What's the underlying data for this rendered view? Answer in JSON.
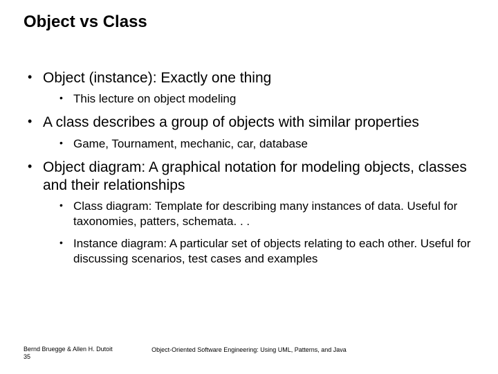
{
  "title": "Object vs Class",
  "bullets": {
    "b1": "Object (instance): Exactly one thing",
    "b1_1": " This lecture on object modeling",
    "b2": "A class describes a group of objects with similar properties",
    "b2_1": "Game,  Tournament, mechanic, car, database",
    "b3": "Object diagram: A graphical notation for modeling objects, classes and their relationships",
    "b3_1": "Class diagram: Template for describing many instances of data. Useful for taxonomies, patters, schemata. . .",
    "b3_2": "Instance diagram: A particular set of objects relating to each other. Useful for discussing scenarios, test cases and examples"
  },
  "footer": {
    "authors": "Bernd Bruegge & Allen H. Dutoit",
    "page": "35",
    "book": "Object-Oriented Software Engineering: Using UML, Patterns, and Java"
  }
}
